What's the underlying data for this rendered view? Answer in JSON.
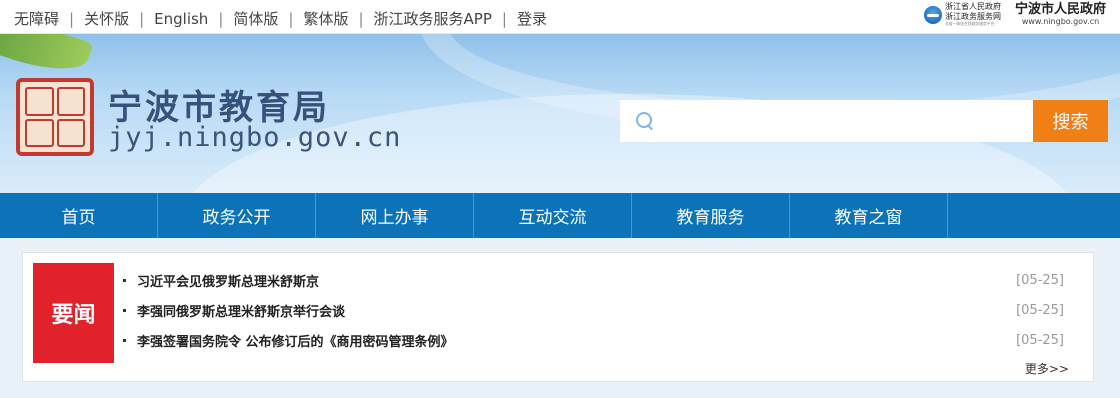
{
  "topbar": {
    "links": [
      "无障碍",
      "关怀版",
      "English",
      "简体版",
      "繁体版",
      "浙江政务服务APP",
      "登录"
    ],
    "separator": "|",
    "zj_logo": {
      "line1": "浙江省人民政府",
      "line2": "浙江政务服务网",
      "line3": "全省一体化在线政务服务平台",
      "icon": "zhejiang-emblem-icon"
    },
    "nb_logo": {
      "name": "宁波市人民政府",
      "url": "www.ningbo.gov.cn"
    }
  },
  "header": {
    "title": "宁波市教育局",
    "url": "jyj.ningbo.gov.cn",
    "seal_icon": "seal-logo-icon",
    "search": {
      "placeholder": "",
      "value": "",
      "button_label": "搜索",
      "icon": "search-icon"
    }
  },
  "nav": {
    "items": [
      "首页",
      "政务公开",
      "网上办事",
      "互动交流",
      "教育服务",
      "教育之窗"
    ]
  },
  "news": {
    "badge": "要闻",
    "items": [
      {
        "title": "习近平会见俄罗斯总理米舒斯京",
        "date": "[05-25]"
      },
      {
        "title": "李强同俄罗斯总理米舒斯京举行会谈",
        "date": "[05-25]"
      },
      {
        "title": "李强签署国务院令 公布修订后的《商用密码管理条例》",
        "date": "[05-25]"
      }
    ],
    "more": "更多>>"
  },
  "colors": {
    "nav_bg": "#0c73b8",
    "search_button": "#f07f16",
    "badge_bg": "#e2222a",
    "title_color": "#36517a"
  }
}
